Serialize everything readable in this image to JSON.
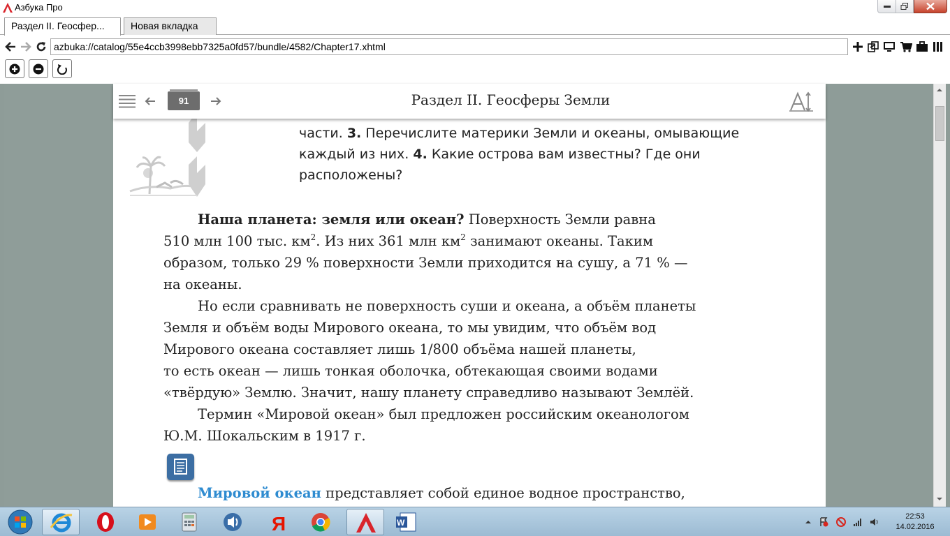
{
  "window": {
    "title": "Азбука Про"
  },
  "tabs": [
    {
      "label": "Раздел II. Геосфер..."
    },
    {
      "label": "Новая вкладка"
    }
  ],
  "navigation": {
    "url": "azbuka://catalog/55e4ccb3998ebb7325a0fd57/bundle/4582/Chapter17.xhtml"
  },
  "reader": {
    "page_number": "91",
    "chapter_title": "Раздел II. Геосферы Земли"
  },
  "content": {
    "questions": {
      "line1_a": "части. ",
      "line1_num": "3.",
      "line1_b": " Перечислите материки Земли и океаны, омывающие",
      "line2_a": "каждый из них. ",
      "line2_num": "4.",
      "line2_b": " Какие острова вам известны? Где они",
      "line3": "расположены?"
    },
    "para1": {
      "heading": "Наша планета: земля или океан?",
      "l1_rest": " Поверхность Земли равна",
      "l2_a": "510 млн 100 тыс. км",
      "l2_sup1": "2",
      "l2_b": ". Из них 361 млн км",
      "l2_sup2": "2",
      "l2_c": " занимают океаны. Таким",
      "l3": "образом, только 29 % поверхности Земли приходится на сушу, а 71 % —",
      "l4": "на океаны."
    },
    "para2": {
      "l1": "Но если сравнивать не поверхность суши и океана, а объём планеты",
      "l2": "Земля и объём воды Мирового океана, то мы увидим, что объём вод",
      "l3": "Мирового океана составляет лишь 1/800 объёма нашей планеты,",
      "l4": "то есть океан — лишь тонкая оболочка, обтекающая своими водами",
      "l5": "«твёрдую» Землю. Значит, нашу планету справедливо называют Землёй."
    },
    "para3": {
      "l1": "Термин «Мировой океан» был предложен российским океанологом",
      "l2": "Ю.М. Шокальским в 1917 г."
    },
    "para4": {
      "term": "Мировой океан",
      "rest": " представляет собой единое водное пространство,"
    }
  },
  "taskbar": {
    "apps": [
      "start",
      "internet-explorer",
      "opera",
      "media-player",
      "calculator",
      "volume",
      "yandex",
      "chrome",
      "azbuka",
      "word"
    ],
    "clock_time": "22:53",
    "clock_date": "14.02.2016"
  },
  "colors": {
    "reader_background": "#8e9c98",
    "term_blue": "#2e8bd0",
    "page_badge": "#6d6d6d",
    "note_icon": "#3c6ea3"
  }
}
